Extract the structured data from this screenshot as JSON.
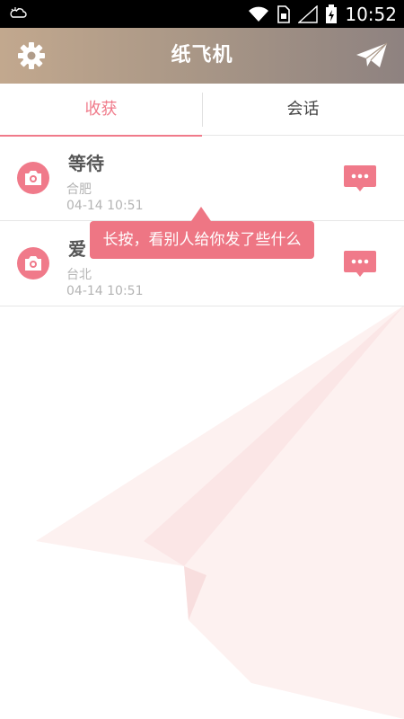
{
  "status_bar": {
    "time": "10:52"
  },
  "app_bar": {
    "title": "纸飞机"
  },
  "tabs": [
    {
      "label": "收获",
      "active": true
    },
    {
      "label": "会话",
      "active": false
    }
  ],
  "list": [
    {
      "title": "等待",
      "location": "合肥",
      "time": "04-14 10:51"
    },
    {
      "title": "爱",
      "location": "台北",
      "time": "04-14 10:51"
    }
  ],
  "tooltip": {
    "text": "长按，看别人给你发了些什么"
  },
  "colors": {
    "accent": "#f07a8a",
    "app_bar_start": "#c2a88e",
    "app_bar_end": "#8e8280"
  }
}
